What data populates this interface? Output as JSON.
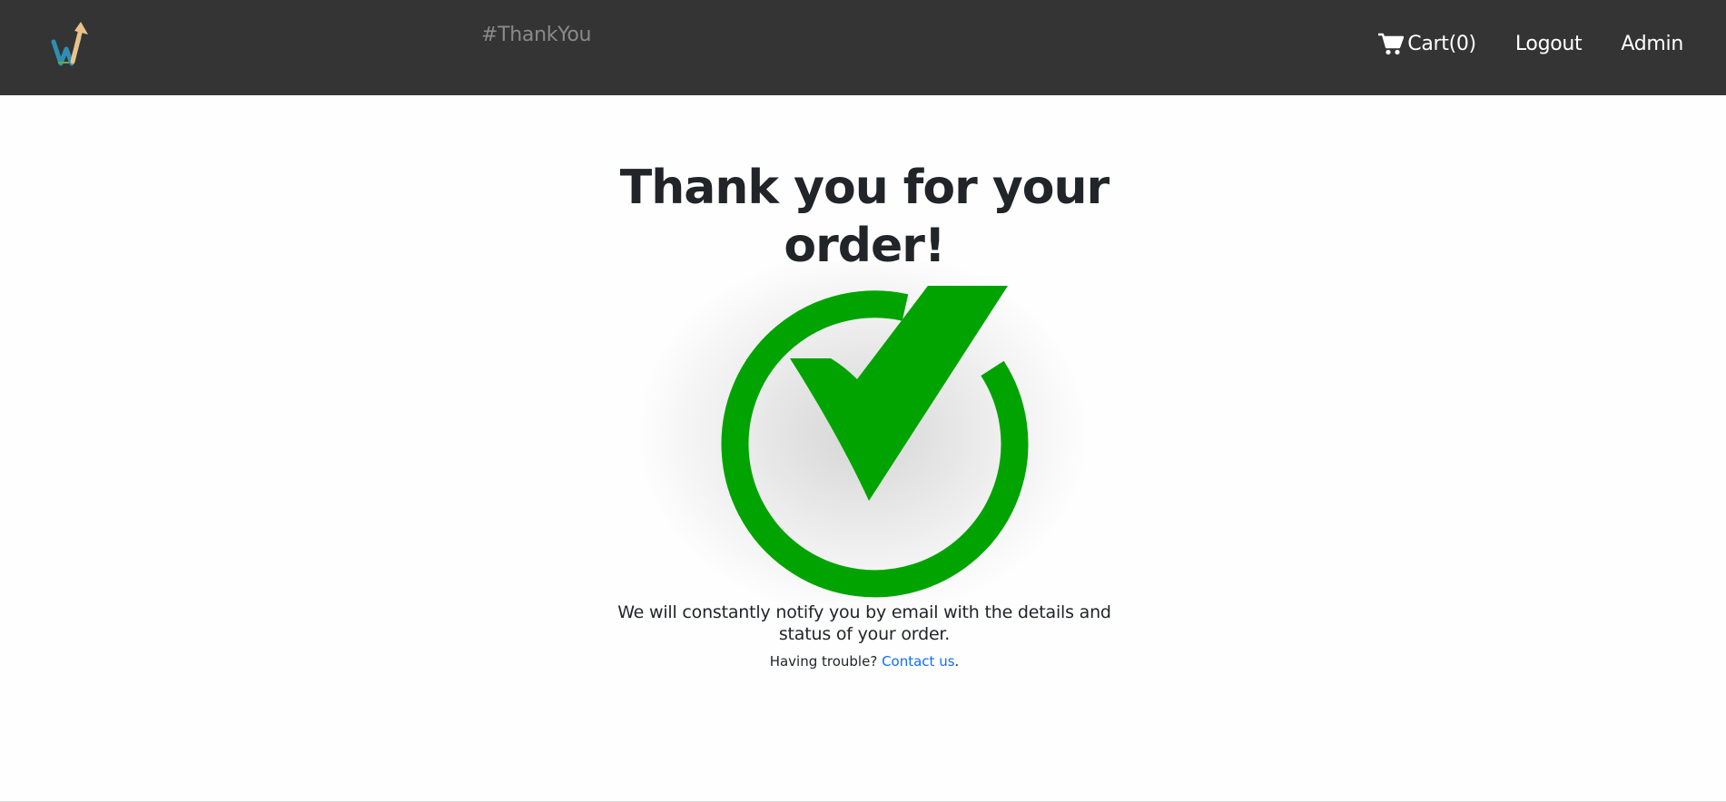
{
  "header": {
    "logo_icon": "growth-arrow-logo-icon",
    "hashtag": "#ThankYou",
    "cart_icon": "shopping-cart-icon",
    "cart_label": "Cart(0)",
    "logout_label": "Logout",
    "admin_label": "Admin"
  },
  "main": {
    "title": "Thank you for your order!",
    "success_icon": "checkmark-circle-icon",
    "message": "We will constantly notify you by email with the details and status of your order.",
    "trouble_text": "Having trouble?",
    "contact_link": "Contact us",
    "trouble_suffix": "."
  },
  "colors": {
    "navbar": "#343434",
    "check_green": "#00a300",
    "link_blue": "#0d6efd",
    "text_dark": "#212529",
    "hashtag_gray": "#8a8a8a"
  }
}
